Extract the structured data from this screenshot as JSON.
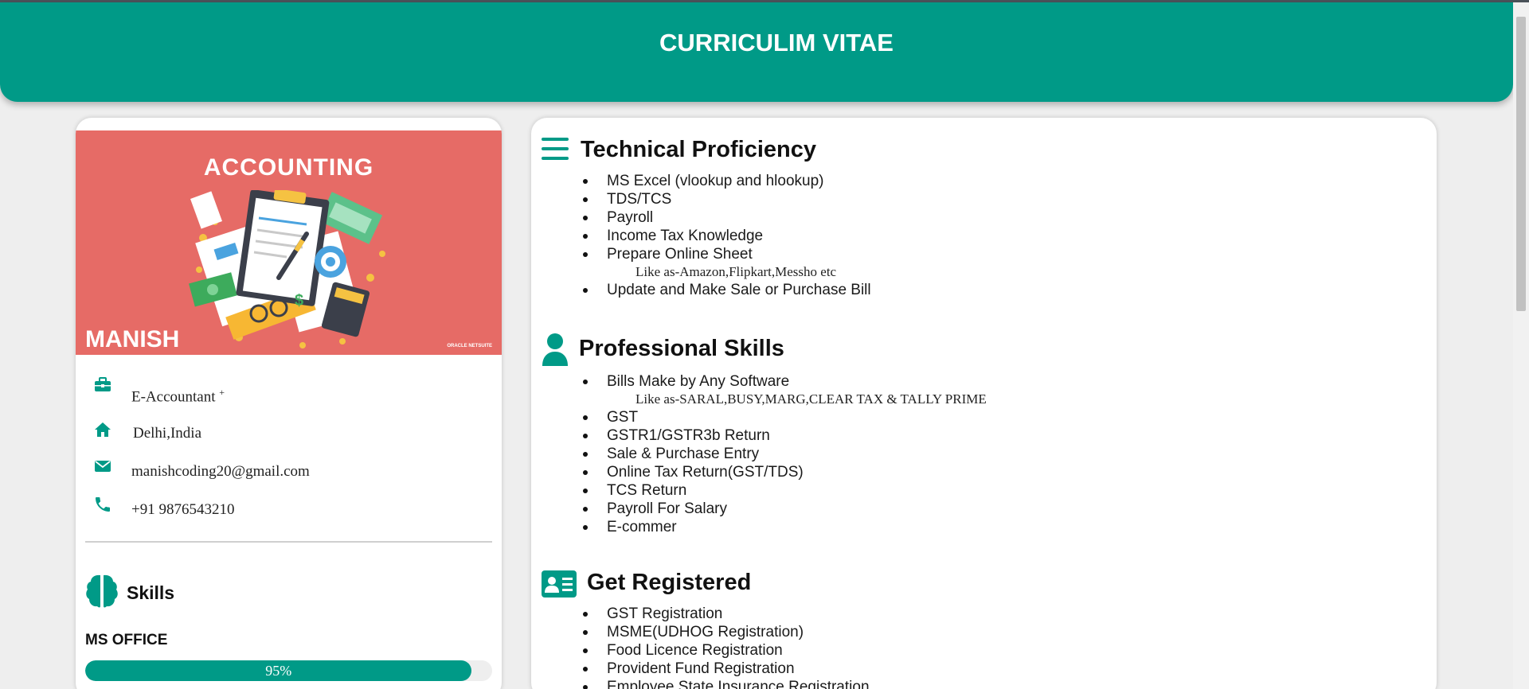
{
  "header": {
    "title": "CURRICULIM VITAE"
  },
  "profile": {
    "banner_title": "ACCOUNTING",
    "banner_credit": "ORACLE NETSUITE",
    "name": "MANISH",
    "job": "E-Accountant",
    "job_suffix": "+",
    "location": "Delhi,India",
    "email": "manishcoding20@gmail.com",
    "phone": "+91 9876543210"
  },
  "skills": {
    "heading": "Skills",
    "items": [
      {
        "name": "MS OFFICE",
        "level_percent": 95,
        "label": "95%"
      }
    ]
  },
  "sections": [
    {
      "title": "Technical Proficiency",
      "icon": "list-icon",
      "items": [
        {
          "text": "MS Excel (vlookup and hlookup)"
        },
        {
          "text": "TDS/TCS"
        },
        {
          "text": "Payroll"
        },
        {
          "text": "Income Tax Knowledge"
        },
        {
          "text": "Prepare Online Sheet",
          "sub": "Like as-Amazon,Flipkart,Messho etc"
        },
        {
          "text": "Update and Make Sale or Purchase Bill"
        }
      ]
    },
    {
      "title": "Professional Skills",
      "icon": "user-icon",
      "items": [
        {
          "text": "Bills Make by Any Software",
          "sub": "Like as-SARAL,BUSY,MARG,CLEAR TAX & TALLY PRIME"
        },
        {
          "text": "GST"
        },
        {
          "text": "GSTR1/GSTR3b Return"
        },
        {
          "text": "Sale & Purchase Entry"
        },
        {
          "text": "Online Tax Return(GST/TDS)"
        },
        {
          "text": "TCS Return"
        },
        {
          "text": "Payroll For Salary"
        },
        {
          "text": "E-commer"
        }
      ]
    },
    {
      "title": "Get Registered",
      "icon": "id-card-icon",
      "items": [
        {
          "text": "GST Registration"
        },
        {
          "text": "MSME(UDHOG Registration)"
        },
        {
          "text": "Food Licence Registration"
        },
        {
          "text": "Provident Fund Registration"
        },
        {
          "text": "Employee State Insurance Registration"
        }
      ]
    }
  ],
  "colors": {
    "accent": "#009a87",
    "banner": "#e66b66",
    "background": "#eeeeee"
  }
}
